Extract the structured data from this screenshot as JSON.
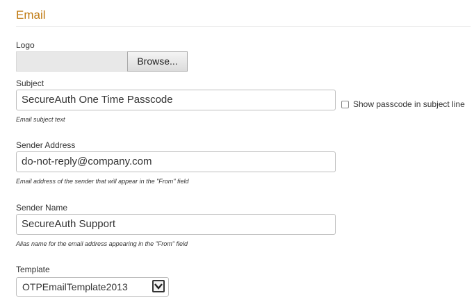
{
  "section": {
    "title": "Email"
  },
  "logo": {
    "label": "Logo",
    "browse_label": "Browse..."
  },
  "subject": {
    "label": "Subject",
    "value": "SecureAuth One Time Passcode",
    "help": "Email subject text",
    "show_passcode_label": "Show passcode in subject line",
    "show_passcode_checked": false
  },
  "sender_address": {
    "label": "Sender Address",
    "value": "do-not-reply@company.com",
    "help": "Email address of the sender that will appear in the \"From\" field"
  },
  "sender_name": {
    "label": "Sender Name",
    "value": "SecureAuth Support",
    "help": "Alias name for the email address appearing in the \"From\" field"
  },
  "template": {
    "label": "Template",
    "selected": "OTPEmailTemplate2013"
  },
  "colors": {
    "section_title": "#c07a12",
    "input_border": "#bdbdbd",
    "file_path_bg": "#e8e8e8"
  },
  "icons": {
    "select_arrow": "chevron-down-icon"
  }
}
